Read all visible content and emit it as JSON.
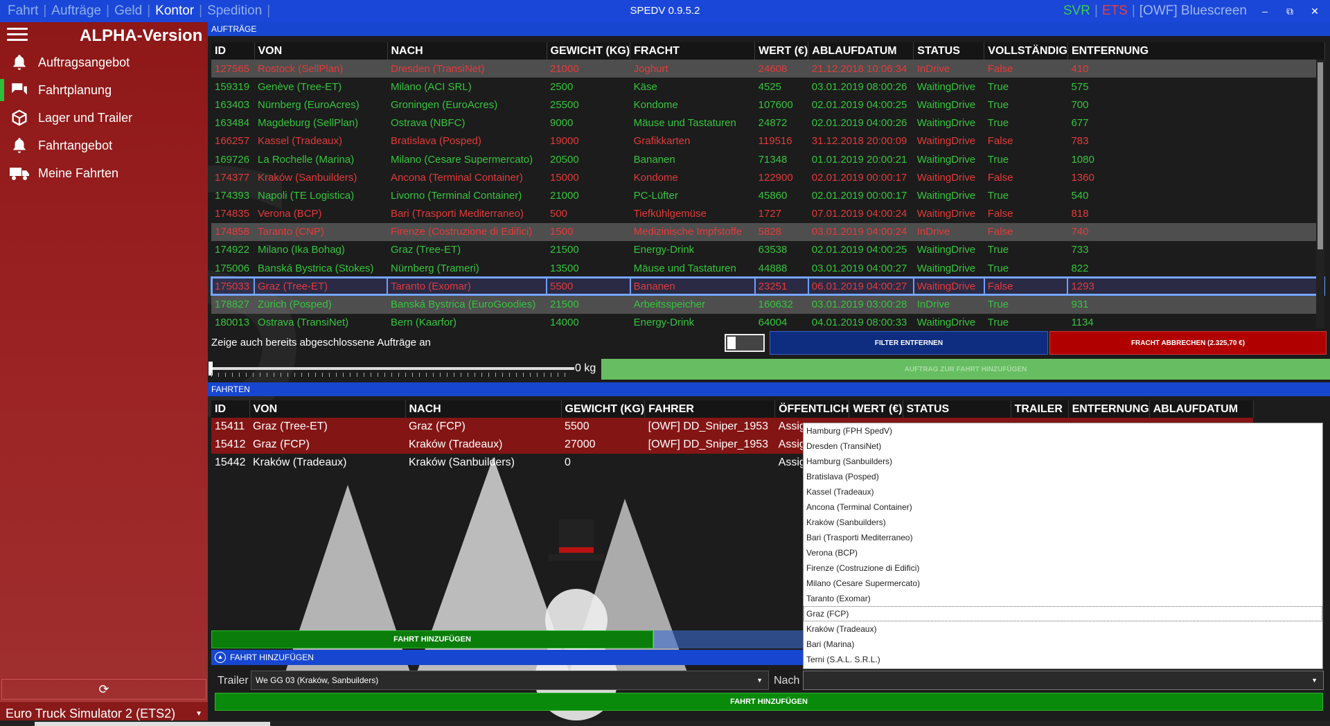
{
  "topbar": {
    "nav": [
      "Fahrt",
      "Aufträge",
      "Geld",
      "Kontor",
      "Spedition"
    ],
    "active_nav": "Kontor",
    "title": "SPEDV 0.9.5.2",
    "svr": "SVR",
    "ets": "ETS",
    "user": "[OWF] Bluescreen",
    "min": "–",
    "max": "⧉",
    "close": "✕"
  },
  "sidebar": {
    "version": "ALPHA-Version",
    "items": [
      {
        "label": "Auftragsangebot",
        "icon": "bell-icon"
      },
      {
        "label": "Fahrtplanung",
        "icon": "chat-icon"
      },
      {
        "label": "Lager und Trailer",
        "icon": "box-icon"
      },
      {
        "label": "Fahrtangebot",
        "icon": "bell-icon"
      },
      {
        "label": "Meine Fahrten",
        "icon": "truck-icon"
      }
    ],
    "refresh_icon": "refresh-icon",
    "game": "Euro Truck Simulator 2 (ETS2)"
  },
  "orders": {
    "section": "AUFTRÄGE",
    "columns": [
      "ID",
      "VON",
      "NACH",
      "GEWICHT (KG)",
      "FRACHT",
      "WERT (€)",
      "ABLAUFDATUM",
      "STATUS",
      "VOLLSTÄNDIG",
      "ENTFERNUNG"
    ],
    "rows": [
      {
        "style": "red-hl",
        "cells": [
          "127565",
          "Rostock (SellPlan)",
          "Dresden (TransiNet)",
          "21000",
          "Joghurt",
          "24608",
          "21.12.2018 10:06:34",
          "InDrive",
          "False",
          "410"
        ]
      },
      {
        "style": "green",
        "cells": [
          "159319",
          "Genève (Tree-ET)",
          "Milano (ACI SRL)",
          "2500",
          "Käse",
          "4525",
          "03.01.2019 08:00:26",
          "WaitingDrive",
          "True",
          "575"
        ]
      },
      {
        "style": "green",
        "cells": [
          "163403",
          "Nürnberg (EuroAcres)",
          "Groningen (EuroAcres)",
          "25500",
          "Kondome",
          "107600",
          "02.01.2019 04:00:25",
          "WaitingDrive",
          "True",
          "700"
        ]
      },
      {
        "style": "green",
        "cells": [
          "163484",
          "Magdeburg (SellPlan)",
          "Ostrava (NBFC)",
          "9000",
          "Mäuse und Tastaturen",
          "24872",
          "02.01.2019 04:00:26",
          "WaitingDrive",
          "True",
          "677"
        ]
      },
      {
        "style": "red",
        "cells": [
          "166257",
          "Kassel (Tradeaux)",
          "Bratislava (Posped)",
          "19000",
          "Grafikkarten",
          "119516",
          "31.12.2018 20:00:09",
          "WaitingDrive",
          "False",
          "783"
        ]
      },
      {
        "style": "green",
        "cells": [
          "169726",
          "La Rochelle (Marina)",
          "Milano (Cesare Supermercato)",
          "20500",
          "Bananen",
          "71348",
          "01.01.2019 20:00:21",
          "WaitingDrive",
          "True",
          "1080"
        ]
      },
      {
        "style": "red",
        "cells": [
          "174377",
          "Kraków (Sanbuilders)",
          "Ancona (Terminal Container)",
          "15000",
          "Kondome",
          "122900",
          "02.01.2019 00:00:17",
          "WaitingDrive",
          "False",
          "1360"
        ]
      },
      {
        "style": "green",
        "cells": [
          "174393",
          "Napoli (TE Logistica)",
          "Livorno (Terminal Container)",
          "21000",
          "PC-Lüfter",
          "45860",
          "02.01.2019 00:00:17",
          "WaitingDrive",
          "True",
          "540"
        ]
      },
      {
        "style": "red",
        "cells": [
          "174835",
          "Verona (BCP)",
          "Bari (Trasporti Mediterraneo)",
          "500",
          "Tiefkühlgemüse",
          "1727",
          "07.01.2019 04:00:24",
          "WaitingDrive",
          "False",
          "818"
        ]
      },
      {
        "style": "red-hl",
        "cells": [
          "174858",
          "Taranto (CNP)",
          "Firenze (Costruzione di Edifici)",
          "1500",
          "Medizinische Impfstoffe",
          "5828",
          "03.01.2019 04:00:24",
          "InDrive",
          "False",
          "740"
        ]
      },
      {
        "style": "green",
        "cells": [
          "174922",
          "Milano (Ika Bohag)",
          "Graz (Tree-ET)",
          "21500",
          "Energy-Drink",
          "63538",
          "02.01.2019 04:00:25",
          "WaitingDrive",
          "True",
          "733"
        ]
      },
      {
        "style": "green",
        "cells": [
          "175006",
          "Banská Bystrica (Stokes)",
          "Nürnberg (Trameri)",
          "13500",
          "Mäuse und Tastaturen",
          "44888",
          "03.01.2019 04:00:27",
          "WaitingDrive",
          "True",
          "822"
        ]
      },
      {
        "style": "red-sel",
        "cells": [
          "175033",
          "Graz (Tree-ET)",
          "Taranto (Exomar)",
          "5500",
          "Bananen",
          "23251",
          "06.01.2019 04:00:27",
          "WaitingDrive",
          "False",
          "1293"
        ]
      },
      {
        "style": "green-hl",
        "cells": [
          "178827",
          "Zürich (Posped)",
          "Banská Bystrica (EuroGoodies)",
          "21500",
          "Arbeitsspeicher",
          "160632",
          "03.01.2019 03:00:28",
          "InDrive",
          "True",
          "931"
        ]
      },
      {
        "style": "green",
        "cells": [
          "180013",
          "Ostrava (TransiNet)",
          "Bern (Kaarfor)",
          "14000",
          "Energy-Drink",
          "64004",
          "04.01.2019 08:00:33",
          "WaitingDrive",
          "True",
          "1134"
        ]
      }
    ],
    "show_done": "Zeige auch bereits abgeschlossene Aufträge an",
    "filter_btn": "FILTER ENTFERNEN",
    "cancel_btn": "FRACHT ABBRECHEN (2.325,70 €)",
    "weight": "0 kg",
    "add_order_btn": "AUFTRAG ZUR FAHRT HINZUFÜGEN"
  },
  "trips": {
    "section": "FAHRTEN",
    "columns": [
      "ID",
      "VON",
      "NACH",
      "GEWICHT (KG)",
      "FAHRER",
      "ÖFFENTLICH",
      "WERT (€)",
      "STATUS",
      "TRAILER",
      "ENTFERNUNG",
      "ABLAUFDATUM"
    ],
    "rows": [
      {
        "style": "red",
        "cells": [
          "15411",
          "Graz (Tree-ET)",
          "Graz (FCP)",
          "5500",
          "[OWF] DD_Sniper_1953",
          "Assig"
        ]
      },
      {
        "style": "red",
        "cells": [
          "15412",
          "Graz (FCP)",
          "Kraków (Tradeaux)",
          "27000",
          "[OWF] DD_Sniper_1953",
          "Assig"
        ]
      },
      {
        "style": "plain",
        "cells": [
          "15442",
          "Kraków (Tradeaux)",
          "Kraków (Sanbuilders)",
          "0",
          "",
          "Assig"
        ]
      }
    ],
    "add_trip_btn": "FAHRT HINZUFÜGEN",
    "collapse_label": "FAHRT HINZUFÜGEN",
    "trailer_label": "Trailer",
    "trailer_value": "We GG 03 (Kraków, Sanbuilders)",
    "nach_label": "Nach",
    "add_trip_btn2": "FAHRT HINZUFÜGEN"
  },
  "dropdown": {
    "options": [
      "Hamburg (FPH SpedV)",
      "Dresden (TransiNet)",
      "Hamburg (Sanbuilders)",
      "Bratislava (Posped)",
      "Kassel (Tradeaux)",
      "Ancona (Terminal Container)",
      "Kraków (Sanbuilders)",
      "Bari (Trasporti Mediterraneo)",
      "Verona (BCP)",
      "Firenze (Costruzione di Edifici)",
      "Milano (Cesare Supermercato)",
      "Taranto (Exomar)",
      "Graz (FCP)",
      "Kraków (Tradeaux)",
      "Bari (Marina)",
      "Terni (S.A.L. S.R.L.)"
    ],
    "selected": "Graz (FCP)"
  },
  "colors": {
    "accent": "#1747d0",
    "sidebar": "#9b2222",
    "green": "#37c43f",
    "red": "#e23b3b"
  }
}
